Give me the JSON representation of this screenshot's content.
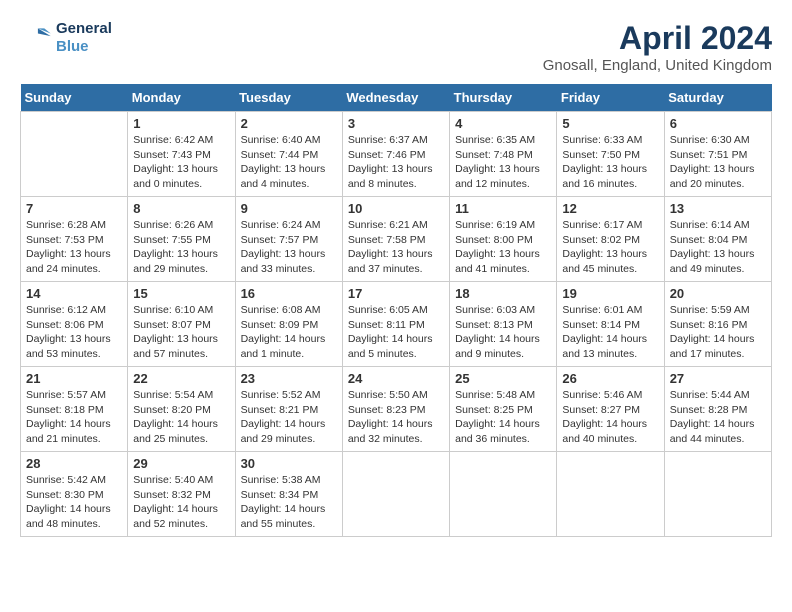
{
  "header": {
    "logo_line1": "General",
    "logo_line2": "Blue",
    "month_year": "April 2024",
    "location": "Gnosall, England, United Kingdom"
  },
  "weekdays": [
    "Sunday",
    "Monday",
    "Tuesday",
    "Wednesday",
    "Thursday",
    "Friday",
    "Saturday"
  ],
  "weeks": [
    [
      {
        "day": "",
        "info": ""
      },
      {
        "day": "1",
        "info": "Sunrise: 6:42 AM\nSunset: 7:43 PM\nDaylight: 13 hours\nand 0 minutes."
      },
      {
        "day": "2",
        "info": "Sunrise: 6:40 AM\nSunset: 7:44 PM\nDaylight: 13 hours\nand 4 minutes."
      },
      {
        "day": "3",
        "info": "Sunrise: 6:37 AM\nSunset: 7:46 PM\nDaylight: 13 hours\nand 8 minutes."
      },
      {
        "day": "4",
        "info": "Sunrise: 6:35 AM\nSunset: 7:48 PM\nDaylight: 13 hours\nand 12 minutes."
      },
      {
        "day": "5",
        "info": "Sunrise: 6:33 AM\nSunset: 7:50 PM\nDaylight: 13 hours\nand 16 minutes."
      },
      {
        "day": "6",
        "info": "Sunrise: 6:30 AM\nSunset: 7:51 PM\nDaylight: 13 hours\nand 20 minutes."
      }
    ],
    [
      {
        "day": "7",
        "info": "Sunrise: 6:28 AM\nSunset: 7:53 PM\nDaylight: 13 hours\nand 24 minutes."
      },
      {
        "day": "8",
        "info": "Sunrise: 6:26 AM\nSunset: 7:55 PM\nDaylight: 13 hours\nand 29 minutes."
      },
      {
        "day": "9",
        "info": "Sunrise: 6:24 AM\nSunset: 7:57 PM\nDaylight: 13 hours\nand 33 minutes."
      },
      {
        "day": "10",
        "info": "Sunrise: 6:21 AM\nSunset: 7:58 PM\nDaylight: 13 hours\nand 37 minutes."
      },
      {
        "day": "11",
        "info": "Sunrise: 6:19 AM\nSunset: 8:00 PM\nDaylight: 13 hours\nand 41 minutes."
      },
      {
        "day": "12",
        "info": "Sunrise: 6:17 AM\nSunset: 8:02 PM\nDaylight: 13 hours\nand 45 minutes."
      },
      {
        "day": "13",
        "info": "Sunrise: 6:14 AM\nSunset: 8:04 PM\nDaylight: 13 hours\nand 49 minutes."
      }
    ],
    [
      {
        "day": "14",
        "info": "Sunrise: 6:12 AM\nSunset: 8:06 PM\nDaylight: 13 hours\nand 53 minutes."
      },
      {
        "day": "15",
        "info": "Sunrise: 6:10 AM\nSunset: 8:07 PM\nDaylight: 13 hours\nand 57 minutes."
      },
      {
        "day": "16",
        "info": "Sunrise: 6:08 AM\nSunset: 8:09 PM\nDaylight: 14 hours\nand 1 minute."
      },
      {
        "day": "17",
        "info": "Sunrise: 6:05 AM\nSunset: 8:11 PM\nDaylight: 14 hours\nand 5 minutes."
      },
      {
        "day": "18",
        "info": "Sunrise: 6:03 AM\nSunset: 8:13 PM\nDaylight: 14 hours\nand 9 minutes."
      },
      {
        "day": "19",
        "info": "Sunrise: 6:01 AM\nSunset: 8:14 PM\nDaylight: 14 hours\nand 13 minutes."
      },
      {
        "day": "20",
        "info": "Sunrise: 5:59 AM\nSunset: 8:16 PM\nDaylight: 14 hours\nand 17 minutes."
      }
    ],
    [
      {
        "day": "21",
        "info": "Sunrise: 5:57 AM\nSunset: 8:18 PM\nDaylight: 14 hours\nand 21 minutes."
      },
      {
        "day": "22",
        "info": "Sunrise: 5:54 AM\nSunset: 8:20 PM\nDaylight: 14 hours\nand 25 minutes."
      },
      {
        "day": "23",
        "info": "Sunrise: 5:52 AM\nSunset: 8:21 PM\nDaylight: 14 hours\nand 29 minutes."
      },
      {
        "day": "24",
        "info": "Sunrise: 5:50 AM\nSunset: 8:23 PM\nDaylight: 14 hours\nand 32 minutes."
      },
      {
        "day": "25",
        "info": "Sunrise: 5:48 AM\nSunset: 8:25 PM\nDaylight: 14 hours\nand 36 minutes."
      },
      {
        "day": "26",
        "info": "Sunrise: 5:46 AM\nSunset: 8:27 PM\nDaylight: 14 hours\nand 40 minutes."
      },
      {
        "day": "27",
        "info": "Sunrise: 5:44 AM\nSunset: 8:28 PM\nDaylight: 14 hours\nand 44 minutes."
      }
    ],
    [
      {
        "day": "28",
        "info": "Sunrise: 5:42 AM\nSunset: 8:30 PM\nDaylight: 14 hours\nand 48 minutes."
      },
      {
        "day": "29",
        "info": "Sunrise: 5:40 AM\nSunset: 8:32 PM\nDaylight: 14 hours\nand 52 minutes."
      },
      {
        "day": "30",
        "info": "Sunrise: 5:38 AM\nSunset: 8:34 PM\nDaylight: 14 hours\nand 55 minutes."
      },
      {
        "day": "",
        "info": ""
      },
      {
        "day": "",
        "info": ""
      },
      {
        "day": "",
        "info": ""
      },
      {
        "day": "",
        "info": ""
      }
    ]
  ]
}
